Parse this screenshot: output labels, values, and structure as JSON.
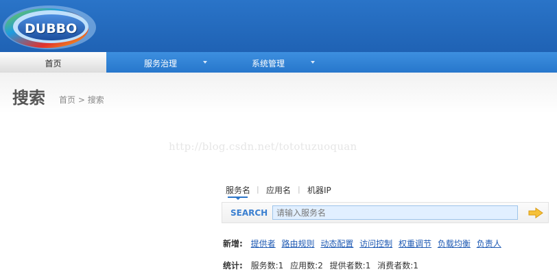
{
  "logo": {
    "text": "DUBBO"
  },
  "nav": {
    "home": "首页",
    "service_governance": "服务治理",
    "system_management": "系统管理"
  },
  "page": {
    "title": "搜索",
    "breadcrumb": {
      "home": "首页",
      "separator": ">",
      "current": "搜索"
    }
  },
  "watermark": "http://blog.csdn.net/tototuzuoquan",
  "search": {
    "tabs": [
      {
        "label": "服务名",
        "active": true
      },
      {
        "label": "应用名",
        "active": false
      },
      {
        "label": "机器IP",
        "active": false
      }
    ],
    "tab_separator": "|",
    "label": "SEARCH",
    "placeholder": "请输入服务名",
    "value": ""
  },
  "add": {
    "label": "新增:",
    "links": [
      "提供者",
      "路由规则",
      "动态配置",
      "访问控制",
      "权重调节",
      "负载均衡",
      "负责人"
    ]
  },
  "stats": {
    "label": "统计:",
    "items": [
      "服务数:1",
      "应用数:2",
      "提供者数:1",
      "消费者数:1"
    ]
  },
  "colors": {
    "header_blue": "#1f62b4",
    "nav_blue": "#2777cc",
    "link_blue": "#1d59b3",
    "search_accent": "#3a7fd0"
  }
}
